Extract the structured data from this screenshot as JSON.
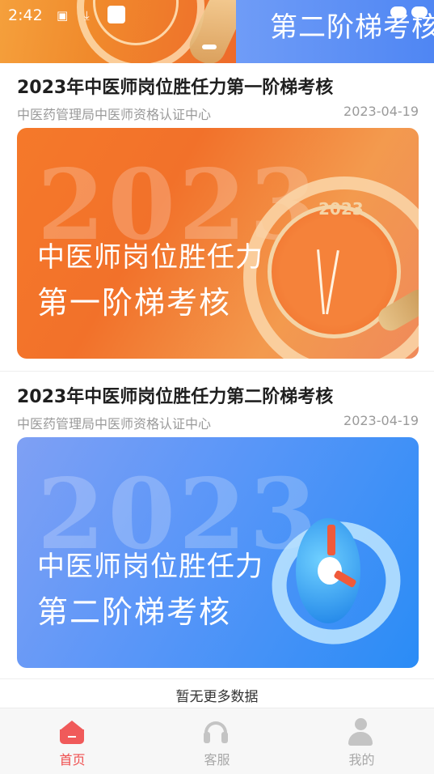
{
  "status_bar": {
    "time": "2:42"
  },
  "top_banner": {
    "right_title": "第二阶梯考核"
  },
  "articles": [
    {
      "title": "2023年中医师岗位胜任力第一阶梯考核",
      "source": "中医药管理局中医师资格认证中心",
      "date": "2023-04-19",
      "card": {
        "year": "2023",
        "line1": "中医师岗位胜任力",
        "line2": "第一阶梯考核",
        "clock_year": "2023",
        "theme_color": "#f2712a"
      }
    },
    {
      "title": "2023年中医师岗位胜任力第二阶梯考核",
      "source": "中医药管理局中医师资格认证中心",
      "date": "2023-04-19",
      "card": {
        "year": "2023",
        "line1": "中医师岗位胜任力",
        "line2": "第二阶梯考核",
        "theme_color": "#2a8cf6"
      }
    }
  ],
  "footer_note": "暂无更多数据",
  "bottom_nav": [
    {
      "label": "首页",
      "icon": "home-icon",
      "active": true
    },
    {
      "label": "客服",
      "icon": "headset-icon",
      "active": false
    },
    {
      "label": "我的",
      "icon": "user-icon",
      "active": false
    }
  ],
  "colors": {
    "accent": "#ef4f4f",
    "inactive": "#a8a8a8"
  }
}
